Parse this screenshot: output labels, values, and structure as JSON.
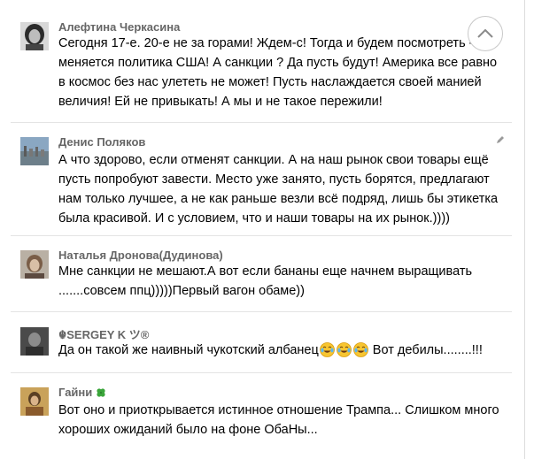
{
  "comments": [
    {
      "author": "Алефтина Черкасина",
      "text": "Сегодня 17-е. 20-е не за горами! Ждем-с! Тогда и будем посмотреть - меняется политика США! А санкции ? Да пусть будут! Америка все равно в космос без нас улететь не может! Пусть наслаждается своей манией величия! Ей не привыкать! А мы и не такое пережили!"
    },
    {
      "author": "Денис Поляков",
      "text": "А что здорово, если отменят санкции. А на наш рынок свои товары ещё пусть попробуют завести. Место уже занято, пусть борятся, предлагают нам только лучшее, а не как раньше везли всё подряд, лишь бы этикетка была красивой. И с условием, что и наши товары на их рынок.))))"
    },
    {
      "author": "Наталья Дронова(Дудинова)",
      "text": "Мне санкции не мешают.А вот если бананы еще начнем выращивать .......совсем ппц)))))Первый вагон обаме))"
    },
    {
      "author": "☬SERGEY K ツ®",
      "text_before": "Да он такой же наивный чукотский албанец",
      "text_after": " Вот дебилы........!!!",
      "emoji": "face-with-tears-of-joy-icon"
    },
    {
      "author": "Гайни",
      "author_badge": "four-leaf-clover-icon",
      "text": "Вот оно и приоткрывается истинное отношение Трампа... Слишком много хороших ожиданий было на фоне ОбаНы..."
    }
  ],
  "icons": {
    "scroll_top": "chevron-up-icon",
    "edit": "pencil-icon"
  },
  "colors": {
    "author": "#666666",
    "separator": "#e4e4e4",
    "clover": "#3aa53a"
  }
}
